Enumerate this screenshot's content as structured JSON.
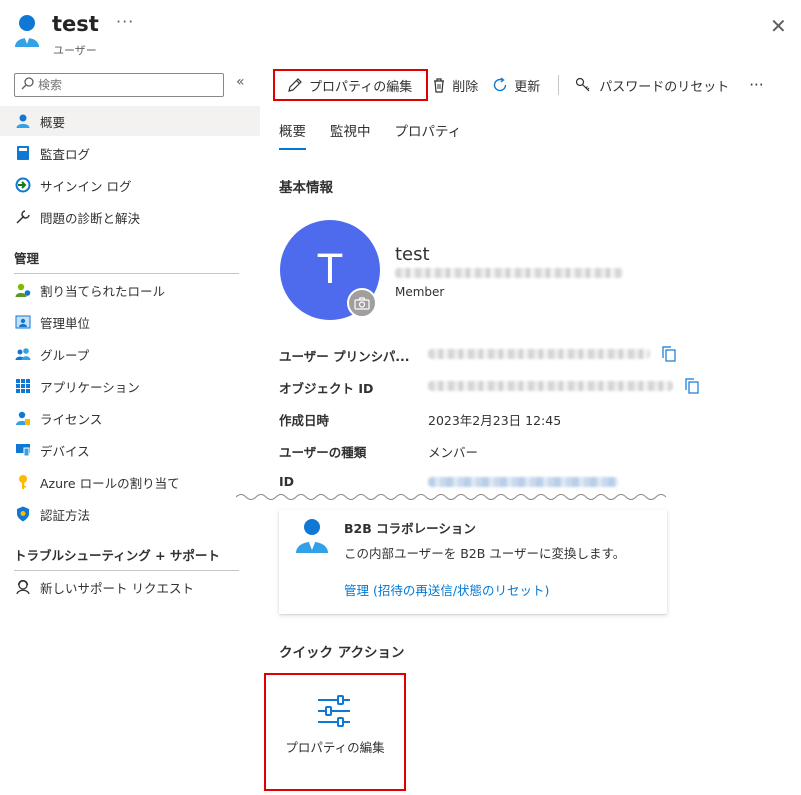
{
  "header": {
    "title": "test",
    "subtitle": "ユーザー",
    "more": "···",
    "close": "✕"
  },
  "sidebar": {
    "search_placeholder": "検索",
    "collapse": "«",
    "items_top": [
      "概要",
      "監査ログ",
      "サインイン ログ",
      "問題の診断と解決"
    ],
    "section_manage": "管理",
    "items_manage": [
      "割り当てられたロール",
      "管理単位",
      "グループ",
      "アプリケーション",
      "ライセンス",
      "デバイス",
      "Azure ロールの割り当て",
      "認証方法"
    ],
    "section_support": "トラブルシューティング + サポート",
    "items_support": [
      "新しいサポート リクエスト"
    ]
  },
  "toolbar": {
    "edit": "プロパティの編集",
    "delete": "削除",
    "refresh": "更新",
    "reset_password": "パスワードのリセット",
    "more": "···"
  },
  "tabs": [
    "概要",
    "監視中",
    "プロパティ"
  ],
  "basic": {
    "heading": "基本情報",
    "avatar_letter": "T",
    "name": "test",
    "member_label": "Member",
    "props": [
      {
        "label": "ユーザー プリンシパ...",
        "value": ""
      },
      {
        "label": "オブジェクト ID",
        "value": ""
      },
      {
        "label": "作成日時",
        "value": "2023年2月23日 12:45"
      },
      {
        "label": "ユーザーの種類",
        "value": "メンバー"
      },
      {
        "label": "ID",
        "value": ""
      }
    ]
  },
  "b2b": {
    "title": "B2B コラボレーション",
    "desc": "この内部ユーザーを B2B ユーザーに変換します。",
    "link": "管理 (招待の再送信/状態のリセット)"
  },
  "quick_actions": {
    "heading": "クイック アクション",
    "tile_label": "プロパティの編集"
  }
}
